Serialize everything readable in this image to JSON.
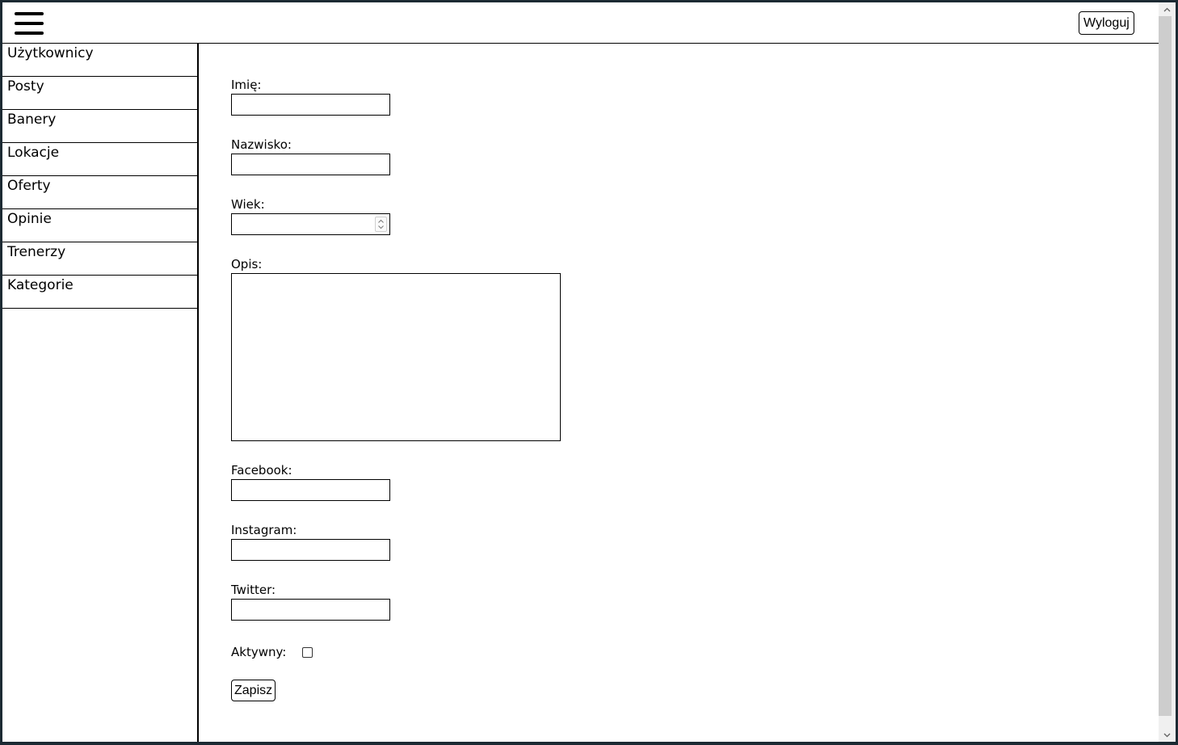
{
  "header": {
    "menu_icon": "hamburger-menu-icon",
    "logout_label": "Wyloguj"
  },
  "sidebar": {
    "items": [
      {
        "label": "Użytkownicy"
      },
      {
        "label": "Posty"
      },
      {
        "label": "Banery"
      },
      {
        "label": "Lokacje"
      },
      {
        "label": "Oferty"
      },
      {
        "label": "Opinie"
      },
      {
        "label": "Trenerzy"
      },
      {
        "label": "Kategorie"
      }
    ]
  },
  "form": {
    "first_name": {
      "label": "Imię:",
      "value": ""
    },
    "last_name": {
      "label": "Nazwisko:",
      "value": ""
    },
    "age": {
      "label": "Wiek:",
      "value": ""
    },
    "description": {
      "label": "Opis:",
      "value": ""
    },
    "facebook": {
      "label": "Facebook:",
      "value": ""
    },
    "instagram": {
      "label": "Instagram:",
      "value": ""
    },
    "twitter": {
      "label": "Twitter:",
      "value": ""
    },
    "active": {
      "label": "Aktywny:",
      "checked": false
    },
    "save_label": "Zapisz"
  }
}
